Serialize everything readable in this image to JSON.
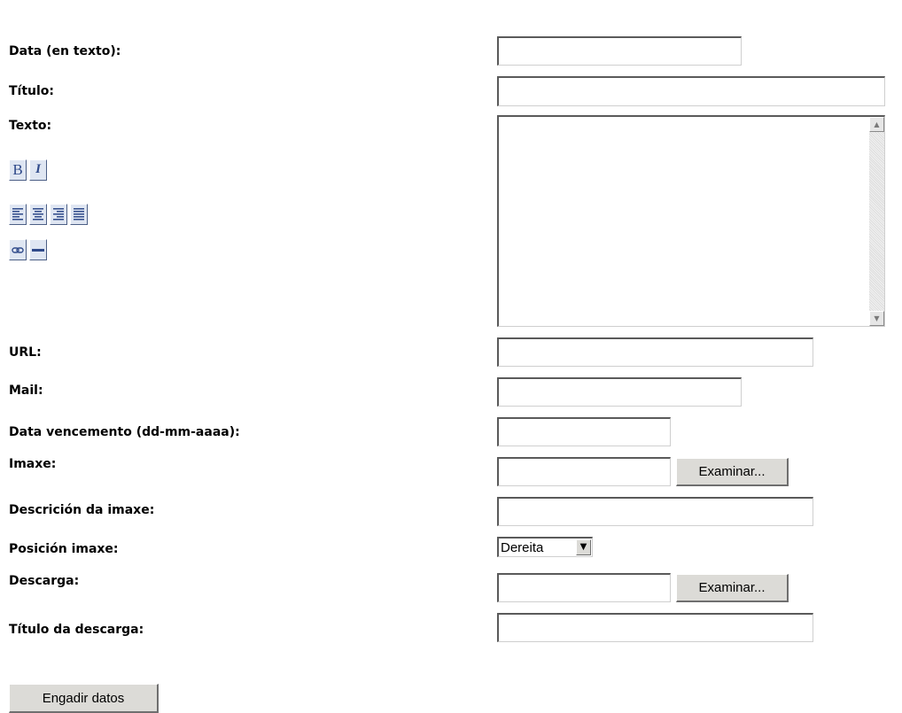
{
  "form": {
    "labels": {
      "date_text": "Data (en texto):",
      "title": "Título:",
      "text": "Texto:",
      "url": "URL:",
      "mail": "Mail:",
      "expiry_date": "Data vencemento (dd-mm-aaaa):",
      "image": "Imaxe:",
      "image_description": "Descrición da imaxe:",
      "image_position": "Posición imaxe:",
      "download": "Descarga:",
      "download_title": "Título da descarga:"
    },
    "values": {
      "date_text": "",
      "title": "",
      "text": "",
      "url": "",
      "mail": "",
      "expiry_date": "",
      "image": "",
      "image_description": "",
      "download": "",
      "download_title": ""
    },
    "browse_label": "Examinar...",
    "image_position_selected": "Dereita",
    "submit_label": "Engadir datos"
  },
  "toolbar": {
    "bold_label": "B",
    "italic_label": "I",
    "icons": [
      "bold-icon",
      "italic-icon",
      "align-left-icon",
      "align-center-icon",
      "align-right-icon",
      "align-justify-icon",
      "link-icon",
      "horizontal-rule-icon"
    ]
  },
  "colors": {
    "toolbar_icon": "#2f4a8a",
    "toolbar_bg": "#dfe6f2",
    "button_bg": "#dcdbd7"
  }
}
